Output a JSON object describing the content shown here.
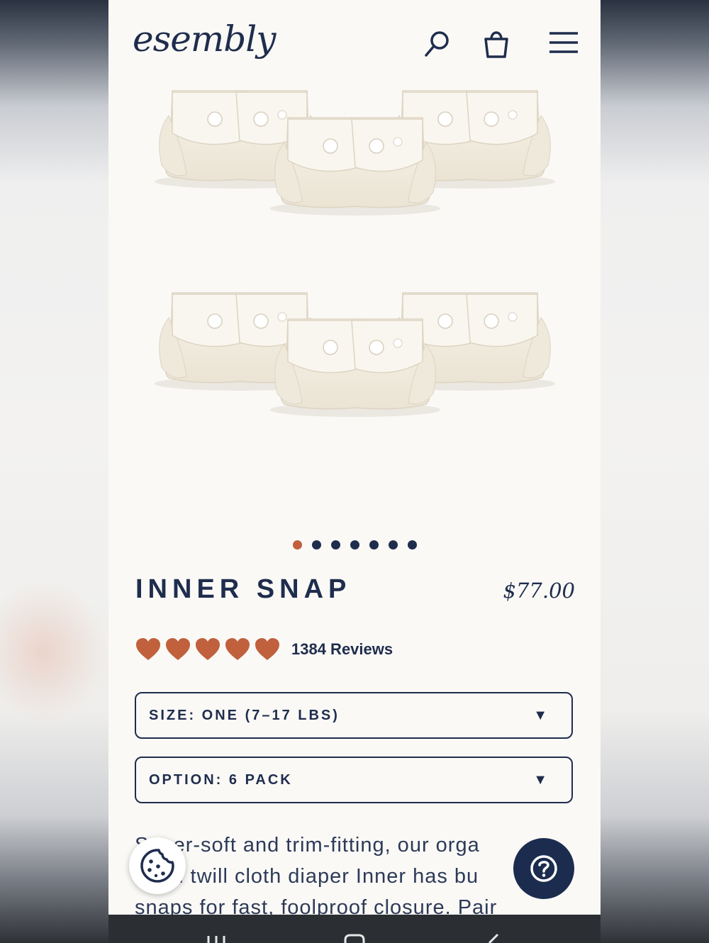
{
  "header": {
    "logo_text": "esembly",
    "icons": [
      "search-icon",
      "shopping-bag-icon",
      "menu-icon"
    ]
  },
  "gallery": {
    "total_images": 7,
    "active_index": 0
  },
  "product": {
    "title": "INNER SNAP",
    "price": "$77.00",
    "rating": 5,
    "reviews_label": "1384 Reviews"
  },
  "options": {
    "size_label": "SIZE: ONE (7–17 LBS)",
    "option_label": "OPTION: 6 PACK"
  },
  "description": {
    "line1": "Super-soft and trim-fitting, our orga",
    "line2": "otton twill cloth diaper Inner has bu",
    "line3": "snaps for fast, foolproof closure. Pair"
  },
  "colors": {
    "navy": "#1f2d4d",
    "accent": "#c0603d",
    "background": "#faf9f6"
  }
}
